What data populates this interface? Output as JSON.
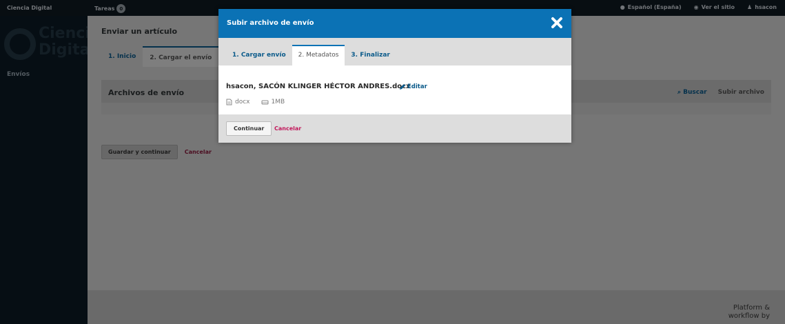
{
  "topbar": {
    "site_name": "Ciencia Digital",
    "tasks_label": "Tareas",
    "tasks_count": "0",
    "language": "Español (España)",
    "view_site": "Ver el sitio",
    "user": "hsacon"
  },
  "sidebar": {
    "logo_line1": "Ciencia",
    "logo_line2": "Digital",
    "nav_item": "Envíos"
  },
  "main": {
    "heading": "Enviar un artículo",
    "tabs": [
      {
        "label": "1. Inicio"
      },
      {
        "label": "2. Cargar el envío"
      }
    ],
    "files_panel": {
      "title": "Archivos de envío",
      "search": "Buscar",
      "upload": "Subir archivo"
    },
    "save_button": "Guardar y continuar",
    "cancel": "Cancelar"
  },
  "footer": {
    "line1": "Platform &",
    "line2": "workflow by"
  },
  "modal": {
    "title": "Subir archivo de envío",
    "tabs": [
      {
        "label": "1. Cargar envío"
      },
      {
        "label": "2. Metadatos"
      },
      {
        "label": "3. Finalizar"
      }
    ],
    "file_name": "hsacon, SACÓN KLINGER HÉCTOR ANDRES.docx",
    "edit_label": "Editar",
    "file_type": "docx",
    "file_size": "1MB",
    "continue_button": "Continuar",
    "cancel_link": "Cancelar"
  },
  "colors": {
    "modal_header": "#0b72b5",
    "link": "#0a5a8a",
    "cancel": "#c2185b"
  }
}
